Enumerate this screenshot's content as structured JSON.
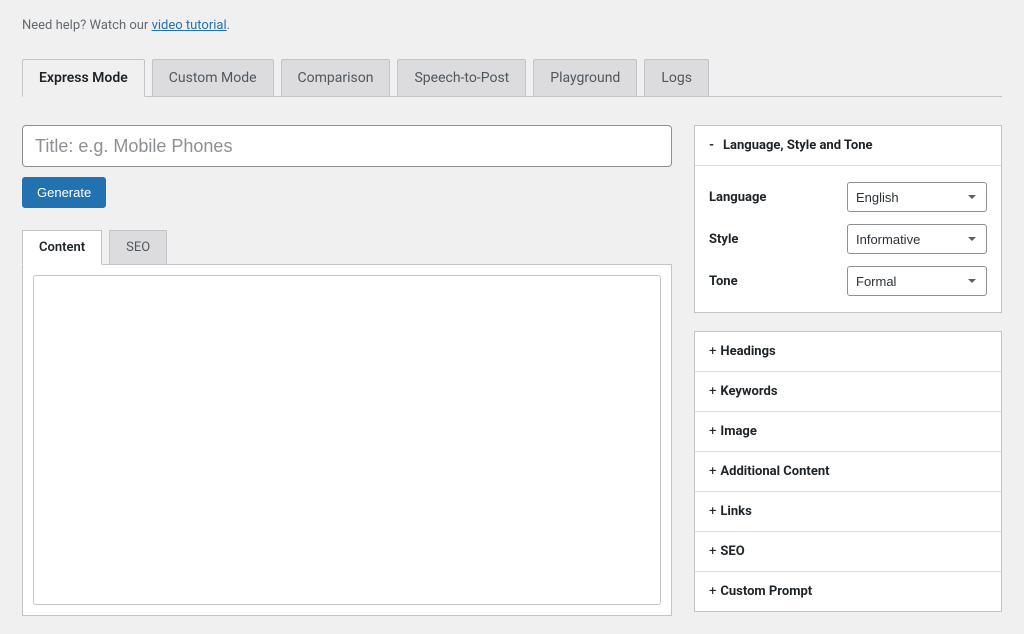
{
  "help": {
    "prefix": "Need help? Watch our ",
    "link": "video tutorial",
    "suffix": "."
  },
  "tabs": [
    {
      "label": "Express Mode",
      "active": true
    },
    {
      "label": "Custom Mode",
      "active": false
    },
    {
      "label": "Comparison",
      "active": false
    },
    {
      "label": "Speech-to-Post",
      "active": false
    },
    {
      "label": "Playground",
      "active": false
    },
    {
      "label": "Logs",
      "active": false
    }
  ],
  "title_placeholder": "Title: e.g. Mobile Phones",
  "generate_label": "Generate",
  "sub_tabs": [
    {
      "label": "Content",
      "active": true
    },
    {
      "label": "SEO",
      "active": false
    }
  ],
  "sidebar": {
    "open_section": {
      "title": "Language, Style and Tone",
      "fields": {
        "language": {
          "label": "Language",
          "value": "English"
        },
        "style": {
          "label": "Style",
          "value": "Informative"
        },
        "tone": {
          "label": "Tone",
          "value": "Formal"
        }
      }
    },
    "collapsed": [
      "Headings",
      "Keywords",
      "Image",
      "Additional Content",
      "Links",
      "SEO",
      "Custom Prompt"
    ]
  }
}
